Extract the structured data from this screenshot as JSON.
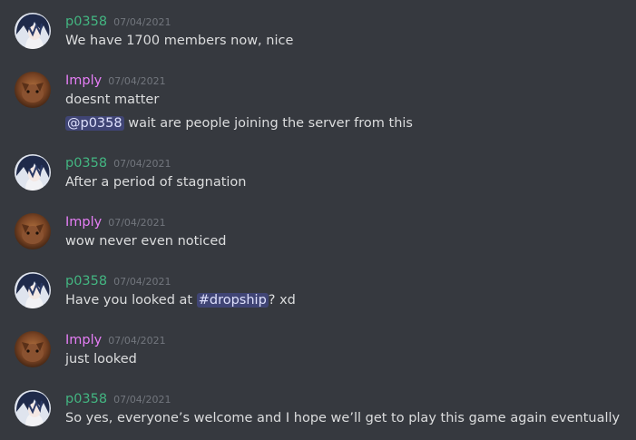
{
  "colors": {
    "background": "#36393f",
    "p0358": "#43b581",
    "imply": "#e57ef5",
    "timestamp": "#72767d",
    "text": "#dcddde",
    "mention_bg": "#434b7b"
  },
  "users": {
    "p0358": {
      "name": "p0358",
      "avatar_icon": "anime-avatar-icon"
    },
    "imply": {
      "name": "Imply",
      "avatar_icon": "cat-avatar-icon"
    }
  },
  "messages": [
    {
      "author": "p0358",
      "timestamp": "07/04/2021",
      "lines": [
        "We have 1700 members now, nice"
      ]
    },
    {
      "author": "Imply",
      "timestamp": "07/04/2021",
      "lines": [
        "doesnt matter"
      ],
      "line2": {
        "mention": "@p0358",
        "text": " wait are people joining the server from this"
      }
    },
    {
      "author": "p0358",
      "timestamp": "07/04/2021",
      "lines": [
        "After a period of stagnation"
      ]
    },
    {
      "author": "Imply",
      "timestamp": "07/04/2021",
      "lines": [
        "wow never even noticed"
      ]
    },
    {
      "author": "p0358",
      "timestamp": "07/04/2021",
      "line_parts": {
        "before": "Have you looked at ",
        "channel": "#dropship",
        "after": "? xd"
      }
    },
    {
      "author": "Imply",
      "timestamp": "07/04/2021",
      "lines": [
        "just looked"
      ]
    },
    {
      "author": "p0358",
      "timestamp": "07/04/2021",
      "lines": [
        "So yes, everyone’s welcome and I hope we’ll get to play this game again eventually"
      ]
    }
  ]
}
